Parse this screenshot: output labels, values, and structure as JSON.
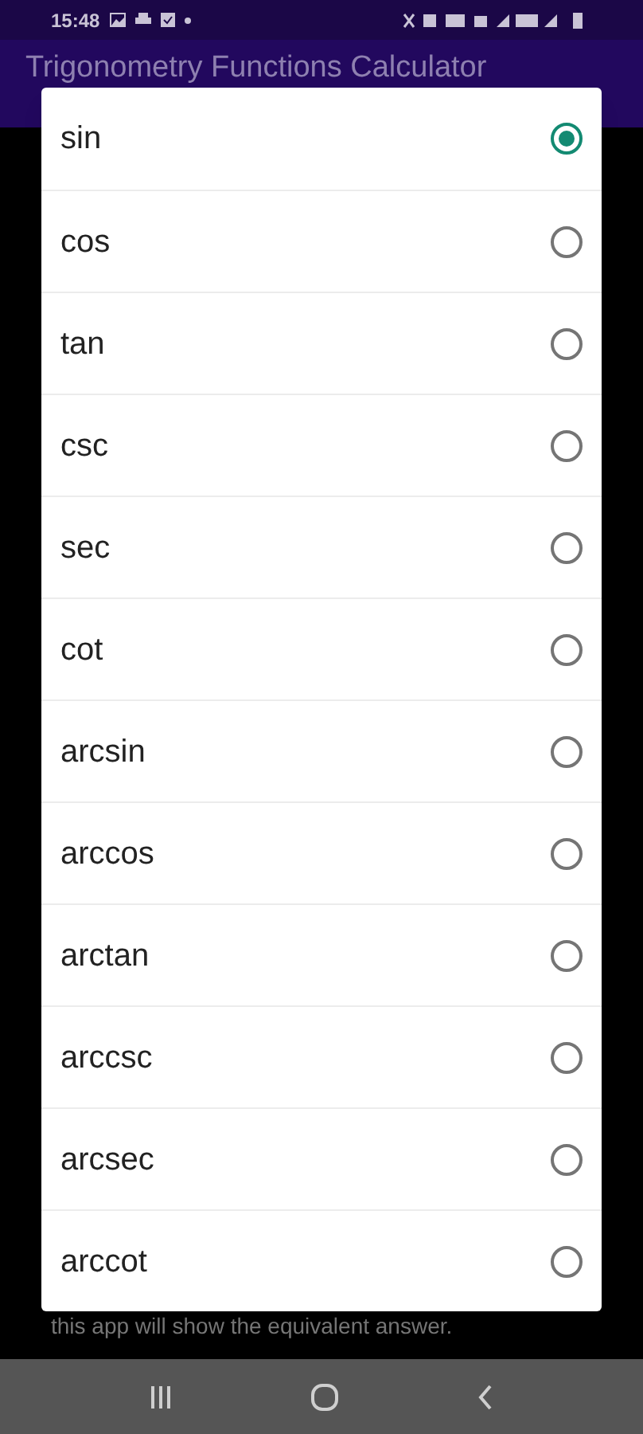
{
  "status_bar": {
    "time": "15:48"
  },
  "app_bar": {
    "title": "Trigonometry Functions Calculator"
  },
  "dialog": {
    "options": [
      {
        "label": "sin",
        "selected": true
      },
      {
        "label": "cos",
        "selected": false
      },
      {
        "label": "tan",
        "selected": false
      },
      {
        "label": "csc",
        "selected": false
      },
      {
        "label": "sec",
        "selected": false
      },
      {
        "label": "cot",
        "selected": false
      },
      {
        "label": "arcsin",
        "selected": false
      },
      {
        "label": "arccos",
        "selected": false
      },
      {
        "label": "arctan",
        "selected": false
      },
      {
        "label": "arccsc",
        "selected": false
      },
      {
        "label": "arcsec",
        "selected": false
      },
      {
        "label": "arccot",
        "selected": false
      }
    ]
  },
  "background_text": "this app will show the equivalent answer."
}
